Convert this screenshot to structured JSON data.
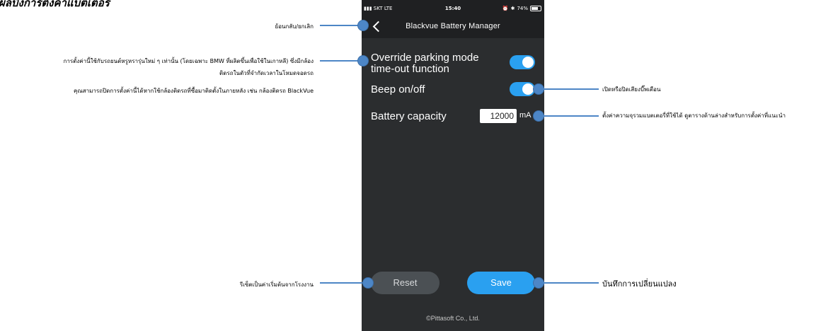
{
  "page_heading": "ผลบังการตั้งค่าแบตเตอรี่",
  "status_bar": {
    "carrier": "SKT",
    "network": "LTE",
    "time": "15:40",
    "battery": "74%"
  },
  "nav": {
    "title": "Blackvue Battery Manager"
  },
  "settings": {
    "override_label_line1": "Override parking mode",
    "override_label_line2": "time-out function",
    "override_on": true,
    "beep_label": "Beep on/off",
    "beep_on": true,
    "capacity_label": "Battery capacity",
    "capacity_value": "12000",
    "capacity_unit": "mA"
  },
  "buttons": {
    "reset": "Reset",
    "save": "Save"
  },
  "footer": {
    "copyright": "©Pittasoft Co., Ltd."
  },
  "annotations": {
    "back": "ย้อนกลับ/ยกเลิก",
    "override_line1": "การตั้งค่านี้ใช้กับรถยนต์หรูหรารุ่นใหม่ ๆ เท่านั้น (โดยเฉพาะ BMW ที่ผลิตขึ้นเพื่อใช้ในเกาหลี) ซึ่งมีกล้อง",
    "override_line2": "ติดรถในตัวที่จำกัดเวลาในโหมดจอดรถ",
    "override_line3": "คุณสามารถปิดการตั้งค่านี้ได้หากใช้กล้องติดรถที่ซื้อมาติดตั้งในภายหลัง เช่น กล้องติดรถ BlackVue",
    "beep": "เปิดหรือปิดเสียงบี๊พเตือน",
    "capacity": "ตั้งค่าความจุรวมแบตเตอรี่ที่ใช้ได้ ดูตารางด้านล่างสำหรับการตั้งค่าที่แนะนำ",
    "reset": "รีเซ็ตเป็นค่าเริ่มต้นจากโรงงาน",
    "save": "บันทึกการเปลี่ยนแปลง"
  },
  "colors": {
    "accent": "#2aa0f0",
    "annotation": "#4d86c6",
    "background": "#2b2d2f"
  }
}
